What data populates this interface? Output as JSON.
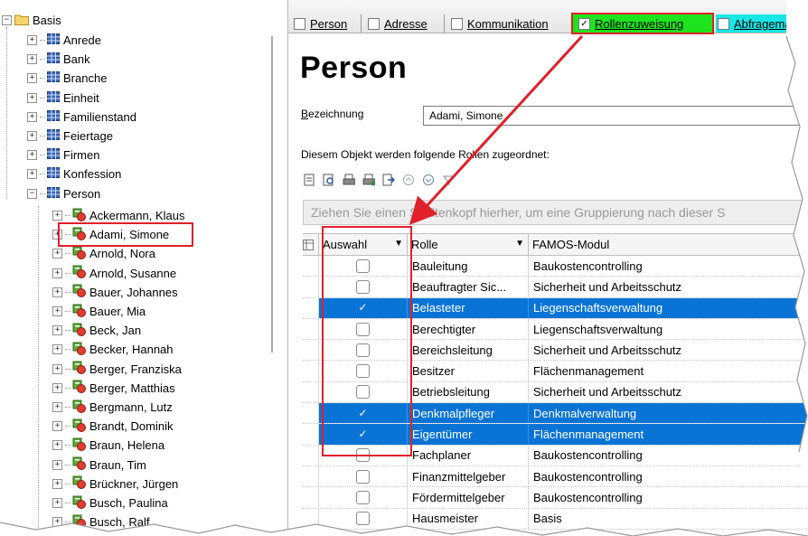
{
  "tree": {
    "root": "Basis",
    "categories": [
      "Anrede",
      "Bank",
      "Branche",
      "Einheit",
      "Familienstand",
      "Feiertage",
      "Firmen",
      "Konfession",
      "Person"
    ],
    "persons": [
      "Ackermann, Klaus",
      "Adami, Simone",
      "Arnold, Nora",
      "Arnold, Susanne",
      "Bauer, Johannes",
      "Bauer, Mia",
      "Beck, Jan",
      "Becker, Hannah",
      "Berger, Franziska",
      "Berger, Matthias",
      "Bergmann, Lutz",
      "Brandt, Dominik",
      "Braun, Helena",
      "Braun, Tim",
      "Brückner, Jürgen",
      "Busch, Paulina",
      "Busch, Ralf"
    ],
    "selected_person": "Adami, Simone"
  },
  "tabs": [
    {
      "label": "Person",
      "checked": false
    },
    {
      "label": "Adresse",
      "checked": false
    },
    {
      "label": "Kommunikation",
      "checked": false
    },
    {
      "label": "Rollenzuweisung",
      "checked": true
    },
    {
      "label": "Abfrageman",
      "checked": false
    }
  ],
  "form": {
    "title": "Person",
    "bezeichnung_label": "Bezeichnung",
    "bezeichnung_value": "Adami, Simone",
    "roles_label": "Diesem Objekt werden folgende Rollen zugeordnet:",
    "group_hint": "Ziehen Sie einen Spaltenkopf hierher, um eine Gruppierung nach dieser S"
  },
  "grid": {
    "headers": {
      "auswahl": "Auswahl",
      "rolle": "Rolle",
      "modul": "FAMOS-Modul"
    },
    "rows": [
      {
        "rolle": "Bauleitung",
        "modul": "Baukostencontrolling",
        "selected": false
      },
      {
        "rolle": "Beauftragter Sic...",
        "modul": "Sicherheit und Arbeitsschutz",
        "selected": false
      },
      {
        "rolle": "Belasteter",
        "modul": "Liegenschaftsverwaltung",
        "selected": true
      },
      {
        "rolle": "Berechtigter",
        "modul": "Liegenschaftsverwaltung",
        "selected": false
      },
      {
        "rolle": "Bereichsleitung",
        "modul": "Sicherheit und Arbeitsschutz",
        "selected": false
      },
      {
        "rolle": "Besitzer",
        "modul": "Flächenmanagement",
        "selected": false
      },
      {
        "rolle": "Betriebsleitung",
        "modul": "Sicherheit und Arbeitsschutz",
        "selected": false
      },
      {
        "rolle": "Denkmalpfleger",
        "modul": "Denkmalverwaltung",
        "selected": true
      },
      {
        "rolle": "Eigentümer",
        "modul": "Flächenmanagement",
        "selected": true
      },
      {
        "rolle": "Fachplaner",
        "modul": "Baukostencontrolling",
        "selected": false
      },
      {
        "rolle": "Finanzmittelgeber",
        "modul": "Baukostencontrolling",
        "selected": false
      },
      {
        "rolle": "Fördermittelgeber",
        "modul": "Baukostencontrolling",
        "selected": false
      },
      {
        "rolle": "Hausmeister",
        "modul": "Basis",
        "selected": false
      }
    ]
  },
  "colors": {
    "selection": "#0a74d6",
    "highlight": "#e0202a",
    "tab_active": "#1de41d",
    "tab_query": "#19e6e6"
  }
}
